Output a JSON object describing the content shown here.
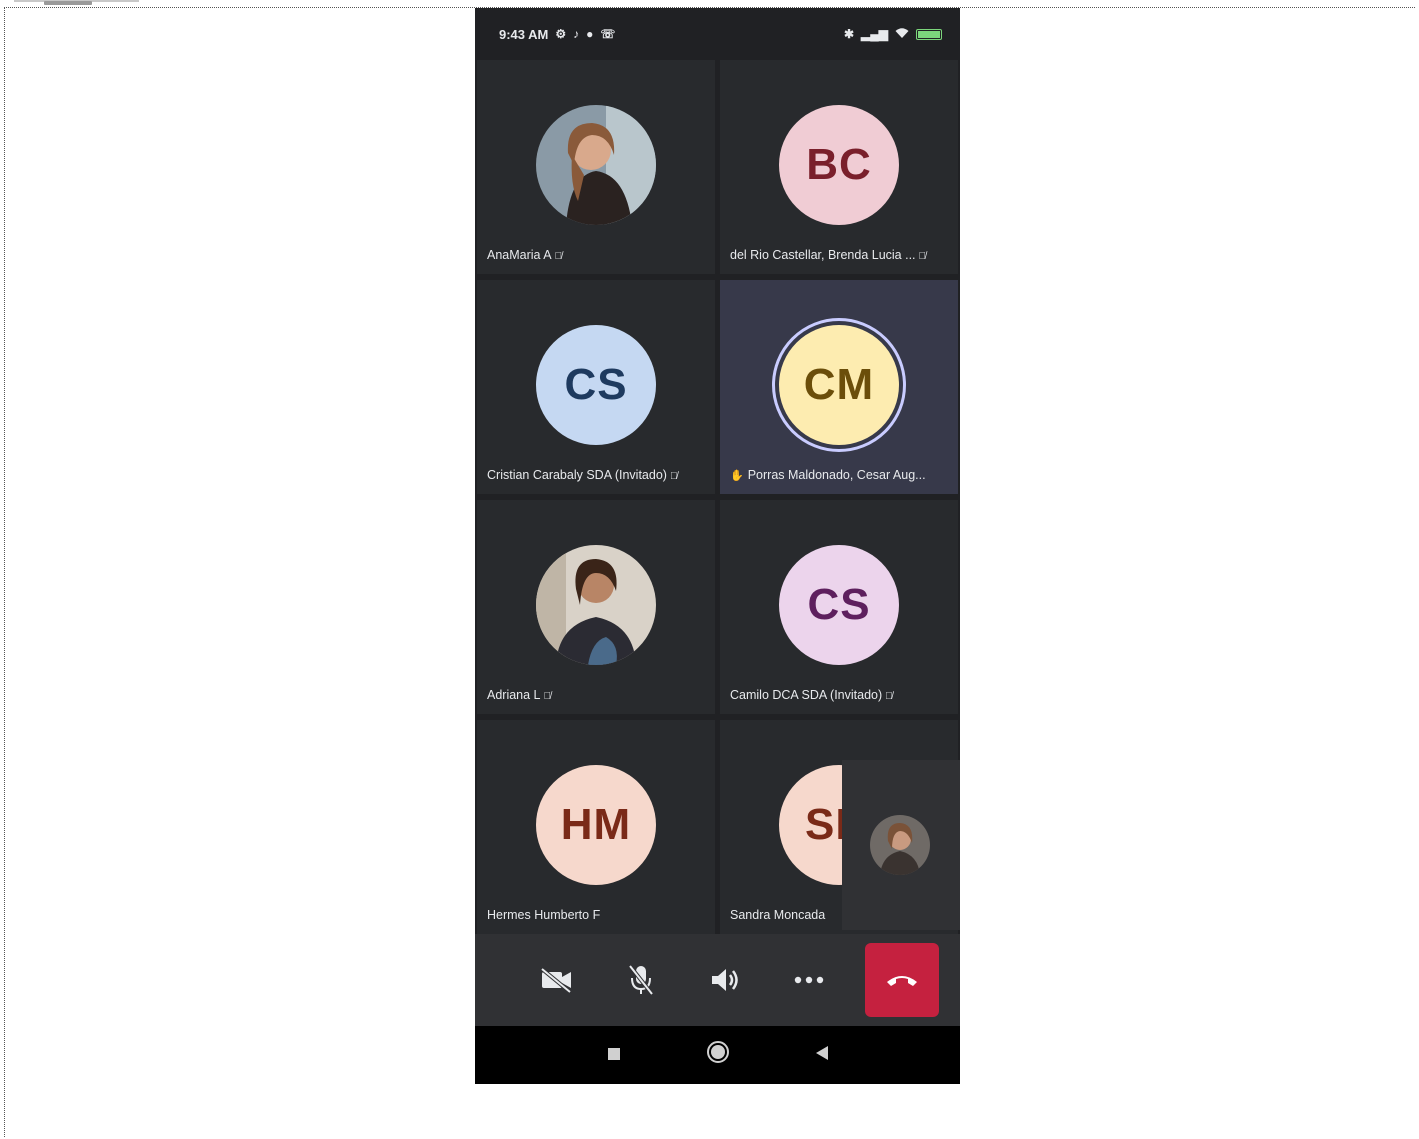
{
  "status_bar": {
    "time": "9:43 AM",
    "left_icons": [
      "settings-icon",
      "tiktok-icon",
      "message-icon",
      "phone-icon"
    ],
    "right_icons": [
      "vibrate-icon",
      "signal-icon",
      "wifi-icon",
      "battery-icon"
    ]
  },
  "participants": [
    {
      "name": "AnaMaria A",
      "initials": "",
      "avatar_type": "photo",
      "muted": true
    },
    {
      "name": "del Rio Castellar, Brenda Lucia ...",
      "initials": "BC",
      "avatar_type": "initials",
      "avatar_bg": "#f0ccd4",
      "avatar_fg": "#7a1f2b",
      "muted": true
    },
    {
      "name": "Cristian Carabaly SDA (Invitado)",
      "initials": "CS",
      "avatar_type": "initials",
      "avatar_bg": "#c5d8f2",
      "avatar_fg": "#1e3a5f",
      "muted": true
    },
    {
      "name": "Porras Maldonado, Cesar Aug...",
      "initials": "CM",
      "avatar_type": "initials",
      "avatar_bg": "#fdecb0",
      "avatar_fg": "#6b4e0a",
      "muted": false,
      "speaking": true,
      "hand_raised": true
    },
    {
      "name": "Adriana L",
      "initials": "",
      "avatar_type": "photo",
      "muted": true
    },
    {
      "name": "Camilo DCA SDA (Invitado)",
      "initials": "CS",
      "avatar_type": "initials",
      "avatar_bg": "#ecd4ec",
      "avatar_fg": "#5e1f5e",
      "muted": true
    },
    {
      "name": "Hermes Humberto F",
      "initials": "HM",
      "avatar_type": "initials",
      "avatar_bg": "#f6d8cc",
      "avatar_fg": "#7a2a18",
      "muted": false
    },
    {
      "name": "Sandra Moncada",
      "initials": "SM",
      "avatar_type": "initials",
      "avatar_bg": "#f6d8cc",
      "avatar_fg": "#7a2a18",
      "muted": false
    }
  ],
  "controls": {
    "camera": "video-off-icon",
    "mic": "mic-off-icon",
    "speaker": "speaker-icon",
    "more": "more-icon",
    "hangup": "hangup-icon",
    "hangup_color": "#c5213f"
  },
  "nav": [
    "square-icon",
    "circle-icon",
    "back-triangle-icon"
  ],
  "colors": {
    "tile_bg": "#282a2d",
    "active_tile_bg": "#37394a",
    "speaking_ring": "#c9ccff"
  }
}
